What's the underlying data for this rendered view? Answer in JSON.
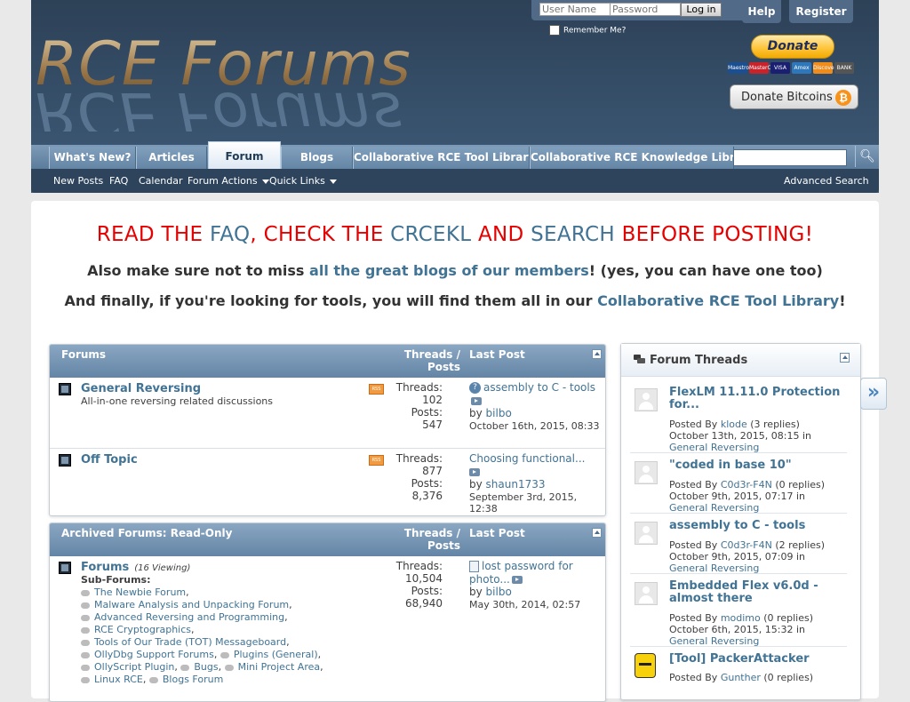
{
  "header": {
    "logo_text": "RCE Forums",
    "login": {
      "username_placeholder": "User Name",
      "password_placeholder": "Password",
      "button": "Log in",
      "remember": "Remember Me?"
    },
    "help": "Help",
    "register": "Register",
    "donate": "Donate",
    "cards": [
      "Maestro",
      "MasterCard",
      "VISA",
      "Amex",
      "Discover",
      "BANK"
    ],
    "donate_bitcoins": "Donate Bitcoins"
  },
  "navtabs": [
    "What's New?",
    "Articles",
    "Forum",
    "Blogs",
    "Collaborative RCE Tool Library",
    "Collaborative RCE Knowledge Library"
  ],
  "subnav": {
    "new_posts": "New Posts",
    "faq": "FAQ",
    "calendar": "Calendar",
    "forum_actions": "Forum Actions",
    "quick_links": "Quick Links",
    "advanced_search": "Advanced Search"
  },
  "notice": {
    "l1": [
      "READ THE ",
      "FAQ",
      ", CHECK THE ",
      "CRCEKL",
      " AND ",
      "SEARCH",
      " BEFORE POSTING!"
    ],
    "l2": [
      "Also make sure not to miss ",
      "all the great blogs of our members",
      "! (yes, you can have one too)"
    ],
    "l3": [
      "And finally, if you're looking for tools, you will find them all in our ",
      "Collaborative RCE Tool Library",
      "!"
    ]
  },
  "forums": {
    "header": "Forums",
    "col_threads": "Threads /",
    "col_posts": "Posts",
    "col_last": "Last Post",
    "rows": [
      {
        "title": "General Reversing",
        "desc": "All-in-one reversing related discussions",
        "threads_label": "Threads:",
        "threads": "102",
        "posts_label": "Posts:",
        "posts": "547",
        "last_title": "assembly to C - tools",
        "by": "by",
        "last_user": "bilbo",
        "last_date": "October 16th, 2015, 08:33"
      },
      {
        "title": "Off Topic",
        "desc": "",
        "threads_label": "Threads:",
        "threads": "877",
        "posts_label": "Posts:",
        "posts": "8,376",
        "last_title": "Choosing functional...",
        "by": "by",
        "last_user": "shaun1733",
        "last_date": "September 3rd, 2015, 12:38"
      }
    ]
  },
  "archived": {
    "header": "Archived Forums: Read-Only",
    "col_threads": "Threads /",
    "col_posts": "Posts",
    "col_last": "Last Post",
    "row": {
      "title": "Forums",
      "viewing": "(16 Viewing)",
      "sub_label": "Sub-Forums:",
      "subforums": [
        "The Newbie Forum",
        "Malware Analysis and Unpacking Forum",
        "Advanced Reversing and Programming",
        "RCE Cryptographics",
        "Tools of Our Trade (TOT) Messageboard",
        "OllyDbg Support Forums",
        "Plugins (General)",
        "OllyScript Plugin",
        "Bugs",
        "Mini Project Area",
        "Linux RCE",
        "Blogs Forum"
      ],
      "threads_label": "Threads:",
      "threads": "10,504",
      "posts_label": "Posts:",
      "posts": "68,940",
      "last_title": "lost password for photo...",
      "by": "by",
      "last_user": "bilbo",
      "last_date": "May 30th, 2014, 02:57"
    }
  },
  "sidebar": {
    "title": "Forum Threads",
    "items": [
      {
        "title": "FlexLM 11.11.0 Protection for...",
        "posted_by": "Posted By",
        "user": "klode",
        "replies": "(3 replies)",
        "date": "October 13th, 2015, 08:15 in",
        "forum": "General Reversing"
      },
      {
        "title": "\"coded in base 10\"",
        "posted_by": "Posted By",
        "user": "C0d3r-F4N",
        "replies": "(0 replies)",
        "date": "October 9th, 2015, 07:17 in",
        "forum": "General Reversing"
      },
      {
        "title": "assembly to C - tools",
        "posted_by": "Posted By",
        "user": "C0d3r-F4N",
        "replies": "(2 replies)",
        "date": "October 9th, 2015, 07:09 in",
        "forum": "General Reversing"
      },
      {
        "title": "Embedded Flex v6.0d - almost there",
        "posted_by": "Posted By",
        "user": "modimo",
        "replies": "(0 replies)",
        "date": "October 6th, 2015, 15:32 in",
        "forum": "General Reversing"
      },
      {
        "title": "[Tool] PackerAttacker",
        "posted_by": "Posted By",
        "user": "Gunther",
        "replies": "(0 replies)",
        "date": "",
        "forum": ""
      }
    ],
    "next": "»"
  }
}
